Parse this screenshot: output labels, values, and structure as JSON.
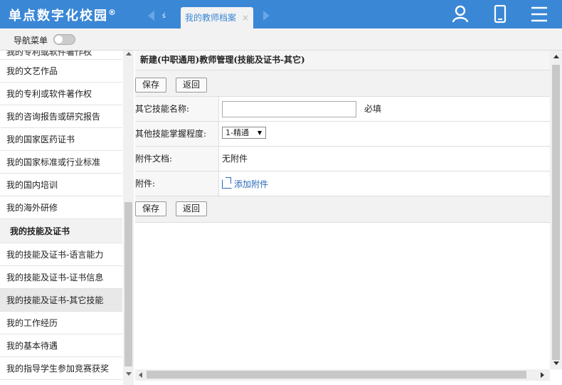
{
  "header": {
    "logo": "单点数字化校园",
    "logo_mark": "®",
    "prev_tab_label": "ś",
    "active_tab_label": "我的教师档案",
    "active_tab_close": "×",
    "icons": [
      "user-icon",
      "mobile-icon",
      "menu-icon"
    ],
    "bar_color": "#3a87d6"
  },
  "nav_toggle": {
    "label": "导航菜单",
    "enabled": false
  },
  "sidebar": {
    "cut_item": "我的专利或软件著作权",
    "items": [
      {
        "label": "我的文艺作品",
        "type": "item"
      },
      {
        "label": "我的专利或软件著作权",
        "type": "item"
      },
      {
        "label": "我的咨询报告或研究报告",
        "type": "item"
      },
      {
        "label": "我的国家医药证书",
        "type": "item"
      },
      {
        "label": "我的国家标准或行业标准",
        "type": "item"
      },
      {
        "label": "我的国内培训",
        "type": "item"
      },
      {
        "label": "我的海外研修",
        "type": "item"
      },
      {
        "label": "我的技能及证书",
        "type": "group"
      },
      {
        "label": "我的技能及证书-语言能力",
        "type": "item"
      },
      {
        "label": "我的技能及证书-证书信息",
        "type": "item"
      },
      {
        "label": "我的技能及证书-其它技能",
        "type": "active"
      },
      {
        "label": "我的工作经历",
        "type": "item"
      },
      {
        "label": "我的基本待遇",
        "type": "item"
      },
      {
        "label": "我的指导学生参加竞赛获奖",
        "type": "item"
      }
    ]
  },
  "main": {
    "title": "新建(中职通用)教师管理(技能及证书-其它)",
    "save_label": "保存",
    "back_label": "返回",
    "form": {
      "skill_name_label": "其它技能名称:",
      "skill_name_value": "",
      "required_label": "必填",
      "mastery_label": "其他技能掌握程度:",
      "mastery_value": "1-精通",
      "doc_label": "附件文档:",
      "doc_value": "无附件",
      "attach_label": "附件:",
      "attach_link": "添加附件"
    }
  }
}
